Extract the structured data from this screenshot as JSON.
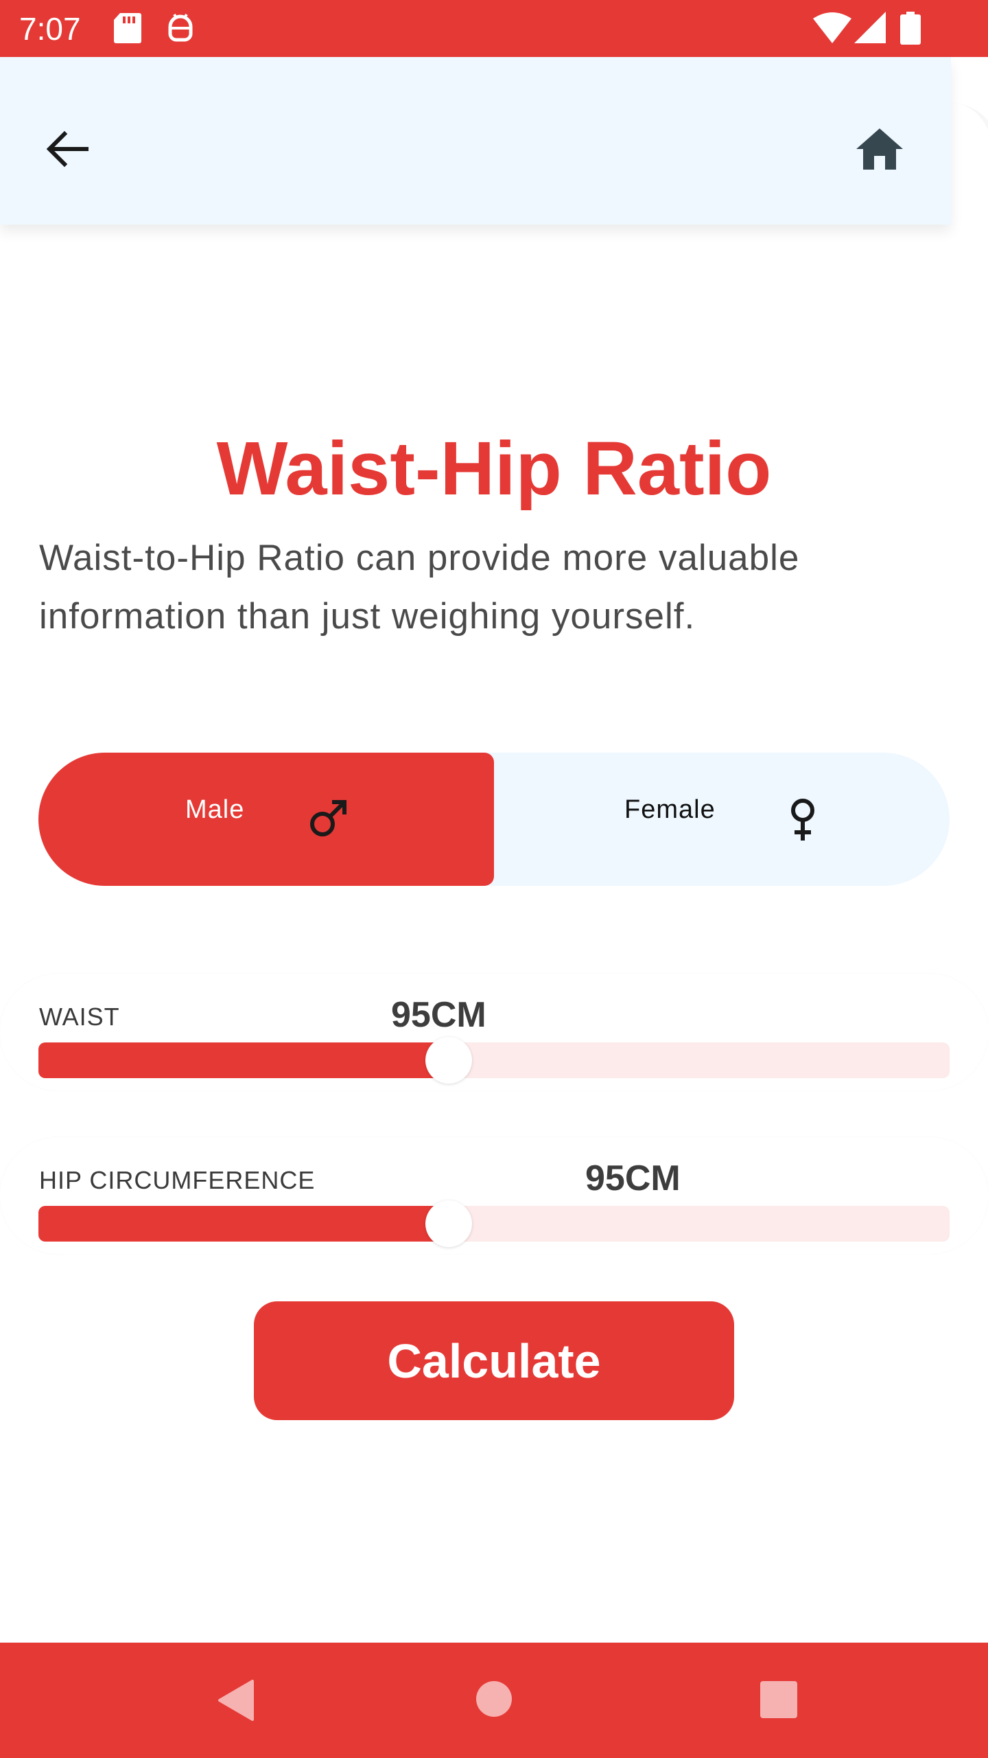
{
  "status_bar": {
    "time": "7:07",
    "icons": [
      "sd-card-icon",
      "android-debug-icon",
      "wifi-icon",
      "cell-signal-icon",
      "battery-icon"
    ]
  },
  "app_bar": {
    "back_icon": "arrow-left-icon",
    "home_icon": "home-icon"
  },
  "page": {
    "title": "Waist-Hip Ratio",
    "description": "Waist-to-Hip Ratio can provide more valuable information than just weighing yourself."
  },
  "gender": {
    "selected": "male",
    "male_label": "Male",
    "female_label": "Female",
    "male_icon": "male-symbol-icon",
    "female_icon": "female-symbol-icon"
  },
  "waist": {
    "label": "WAIST",
    "value_text": "95CM",
    "fill_fraction": 0.45
  },
  "hip": {
    "label": "HIP CIRCUMFERENCE",
    "value_text": "95CM",
    "fill_fraction": 0.45
  },
  "actions": {
    "calculate_label": "Calculate"
  },
  "nav_bar": {
    "icons": [
      "back-triangle-icon",
      "home-circle-icon",
      "recents-square-icon"
    ]
  },
  "colors": {
    "accent": "#e53935",
    "appbar_bg": "#eff8ff",
    "track_bg": "#fdeaea"
  }
}
